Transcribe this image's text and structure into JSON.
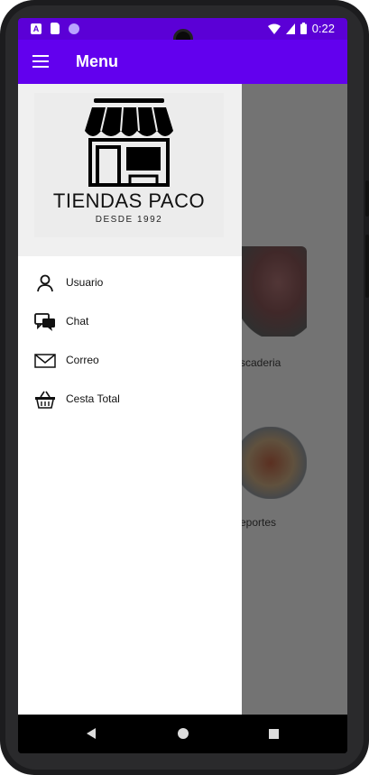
{
  "status_bar": {
    "time": "0:22",
    "left_icons": [
      "notification-a-icon",
      "sd-card-icon",
      "circle-dot-icon"
    ],
    "right_icons": [
      "wifi-icon",
      "signal-icon",
      "battery-icon"
    ]
  },
  "app_bar": {
    "title": "Menu",
    "nav_icon": "hamburger-menu-icon",
    "color": "#6200ee"
  },
  "drawer": {
    "brand": {
      "name": "TIENDAS PACO",
      "tagline": "DESDE 1992",
      "logo_icon": "storefront-icon"
    },
    "items": [
      {
        "label": "Usuario",
        "icon": "user-icon"
      },
      {
        "label": "Chat",
        "icon": "chat-icon"
      },
      {
        "label": "Correo",
        "icon": "mail-icon"
      },
      {
        "label": "Cesta Total",
        "icon": "basket-icon"
      }
    ]
  },
  "background": {
    "categories": [
      {
        "label": "scaderia"
      },
      {
        "label": "eportes"
      }
    ]
  },
  "nav_bar": {
    "icons": [
      "back-icon",
      "home-icon",
      "recents-icon"
    ]
  }
}
